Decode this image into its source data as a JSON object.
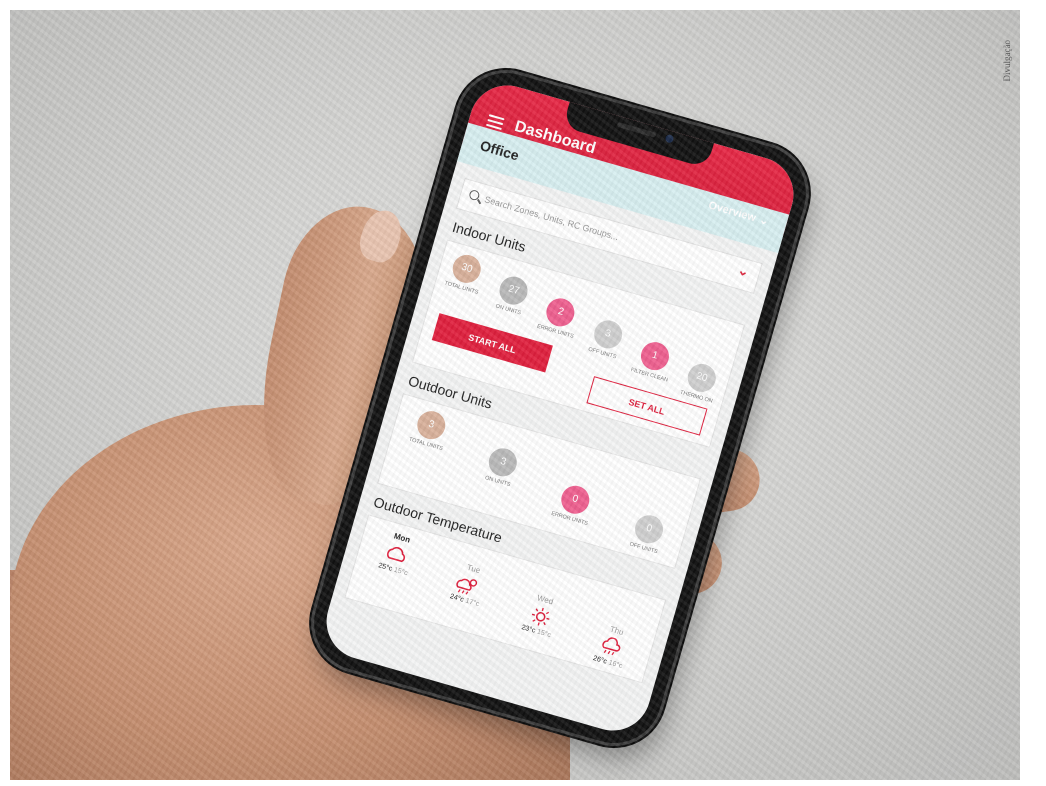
{
  "credit": "Divulgação",
  "header": {
    "title": "Dashboard"
  },
  "context": {
    "site": "Office",
    "view": "Overview"
  },
  "search": {
    "placeholder": "Search Zones, Units, RC Groups..."
  },
  "indoor": {
    "title": "Indoor Units",
    "units": [
      {
        "value": "30",
        "label": "TOTAL UNITS",
        "color": "#d8b09a"
      },
      {
        "value": "27",
        "label": "ON UNITS",
        "color": "#b9b9b9"
      },
      {
        "value": "2",
        "label": "ERROR UNITS",
        "color": "#ee5f8f"
      },
      {
        "value": "3",
        "label": "OFF UNITS",
        "color": "#cfcfcf"
      },
      {
        "value": "1",
        "label": "FILTER CLEAN",
        "color": "#ee5f8f"
      },
      {
        "value": "20",
        "label": "THERMO ON",
        "color": "#cfcfcf"
      }
    ],
    "start_all": "START ALL",
    "set_all": "SET ALL"
  },
  "outdoor": {
    "title": "Outdoor Units",
    "units": [
      {
        "value": "3",
        "label": "TOTAL UNITS",
        "color": "#d8b09a"
      },
      {
        "value": "3",
        "label": "ON UNITS",
        "color": "#b9b9b9"
      },
      {
        "value": "0",
        "label": "ERROR UNITS",
        "color": "#ee5f8f"
      },
      {
        "value": "0",
        "label": "OFF UNITS",
        "color": "#cfcfcf"
      }
    ]
  },
  "temperature": {
    "title": "Outdoor Temperature",
    "days": [
      {
        "day": "Mon",
        "high": "25°c",
        "low": "15°c",
        "icon": "cloudy-icon"
      },
      {
        "day": "Tue",
        "high": "24°c",
        "low": "17°c",
        "icon": "sun-rain-icon"
      },
      {
        "day": "Wed",
        "high": "23°c",
        "low": "15°c",
        "icon": "sun-icon"
      },
      {
        "day": "Thu",
        "high": "26°c",
        "low": "16°c",
        "icon": "rain-icon"
      }
    ]
  },
  "colors": {
    "accent": "#e01f3d",
    "header": "#e62745",
    "context_bar": "#d7eef0"
  }
}
